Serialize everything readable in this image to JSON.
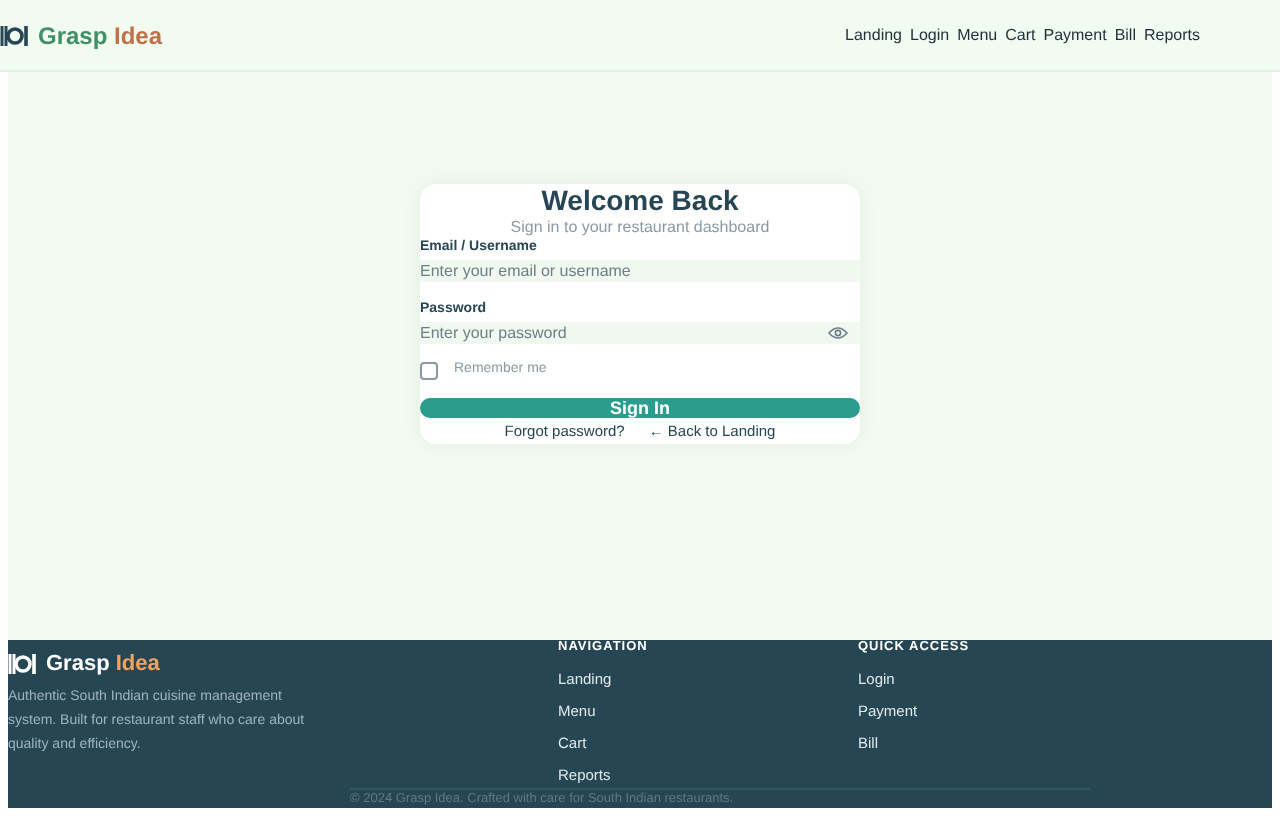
{
  "header": {
    "brand": [
      "Grasp",
      "Idea"
    ],
    "nav": [
      "Landing",
      "Login",
      "Menu",
      "Cart",
      "Payment",
      "Bill",
      "Reports"
    ]
  },
  "login": {
    "title": "Welcome Back",
    "subtitle": "Sign in to your restaurant dashboard",
    "fields": [
      {
        "label": "Email / Username",
        "placeholder": "Enter your email or username",
        "kind": "text"
      },
      {
        "label": "Password",
        "placeholder": "Enter your password",
        "kind": "password"
      }
    ],
    "remember": {
      "label": "Remember me",
      "checked": false
    },
    "submit": "Sign In",
    "links": [
      "Forgot password?",
      "← Back to Landing"
    ]
  },
  "footer": {
    "brand": [
      "Grasp",
      "Idea"
    ],
    "description": "Authentic South Indian cuisine management system. Built for restaurant staff who care about quality and efficiency.",
    "columns": [
      {
        "heading": "NAVIGATION",
        "links": [
          "Landing",
          "Menu",
          "Cart",
          "Reports"
        ]
      },
      {
        "heading": "QUICK ACCESS",
        "links": [
          "Login",
          "Payment",
          "Bill"
        ]
      }
    ],
    "copyright": "© 2024 Grasp Idea. Crafted with care for South Indian restaurants."
  }
}
